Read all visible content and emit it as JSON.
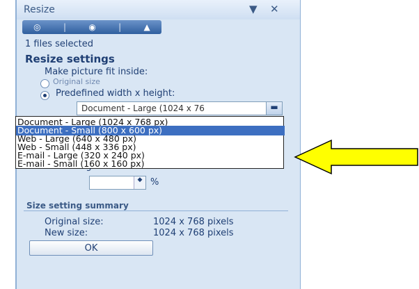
{
  "titlebar": {
    "title": "Resize",
    "pin_glyph": "▼",
    "close_glyph": "✕"
  },
  "tabs": [
    {
      "icon": "picture-icon"
    },
    {
      "icon": "picture-edit-icon"
    },
    {
      "icon": "mountain-picture-icon"
    }
  ],
  "status": "1 files selected",
  "resize_settings": {
    "heading": "Resize settings",
    "fit_label": "Make picture fit inside:",
    "original_label": "Original size",
    "predefined_label": "Predefined width x height:",
    "selected_value": "Document - Large (1024 x 76",
    "options": [
      "Document - Large (1024 x 768 px)",
      "Document - Small (800 x 600 px)",
      "Web - Large (640 x 480 px)",
      "Web - Small (448 x 336 px)",
      "E-mail - Large (320 x 240 px)",
      "E-mail - Small (160 x 160 px)"
    ],
    "selected_option_index": 1,
    "height_label": "Height:",
    "height_unit": "%"
  },
  "summary": {
    "heading": "Size setting summary",
    "original_label": "Original size:",
    "original_value": "1024 x 768 pixels",
    "new_label": "New size:",
    "new_value": "1024 x 768 pixels"
  },
  "ok_label": "OK",
  "annotation": {
    "arrow_color": "#ffff00"
  }
}
